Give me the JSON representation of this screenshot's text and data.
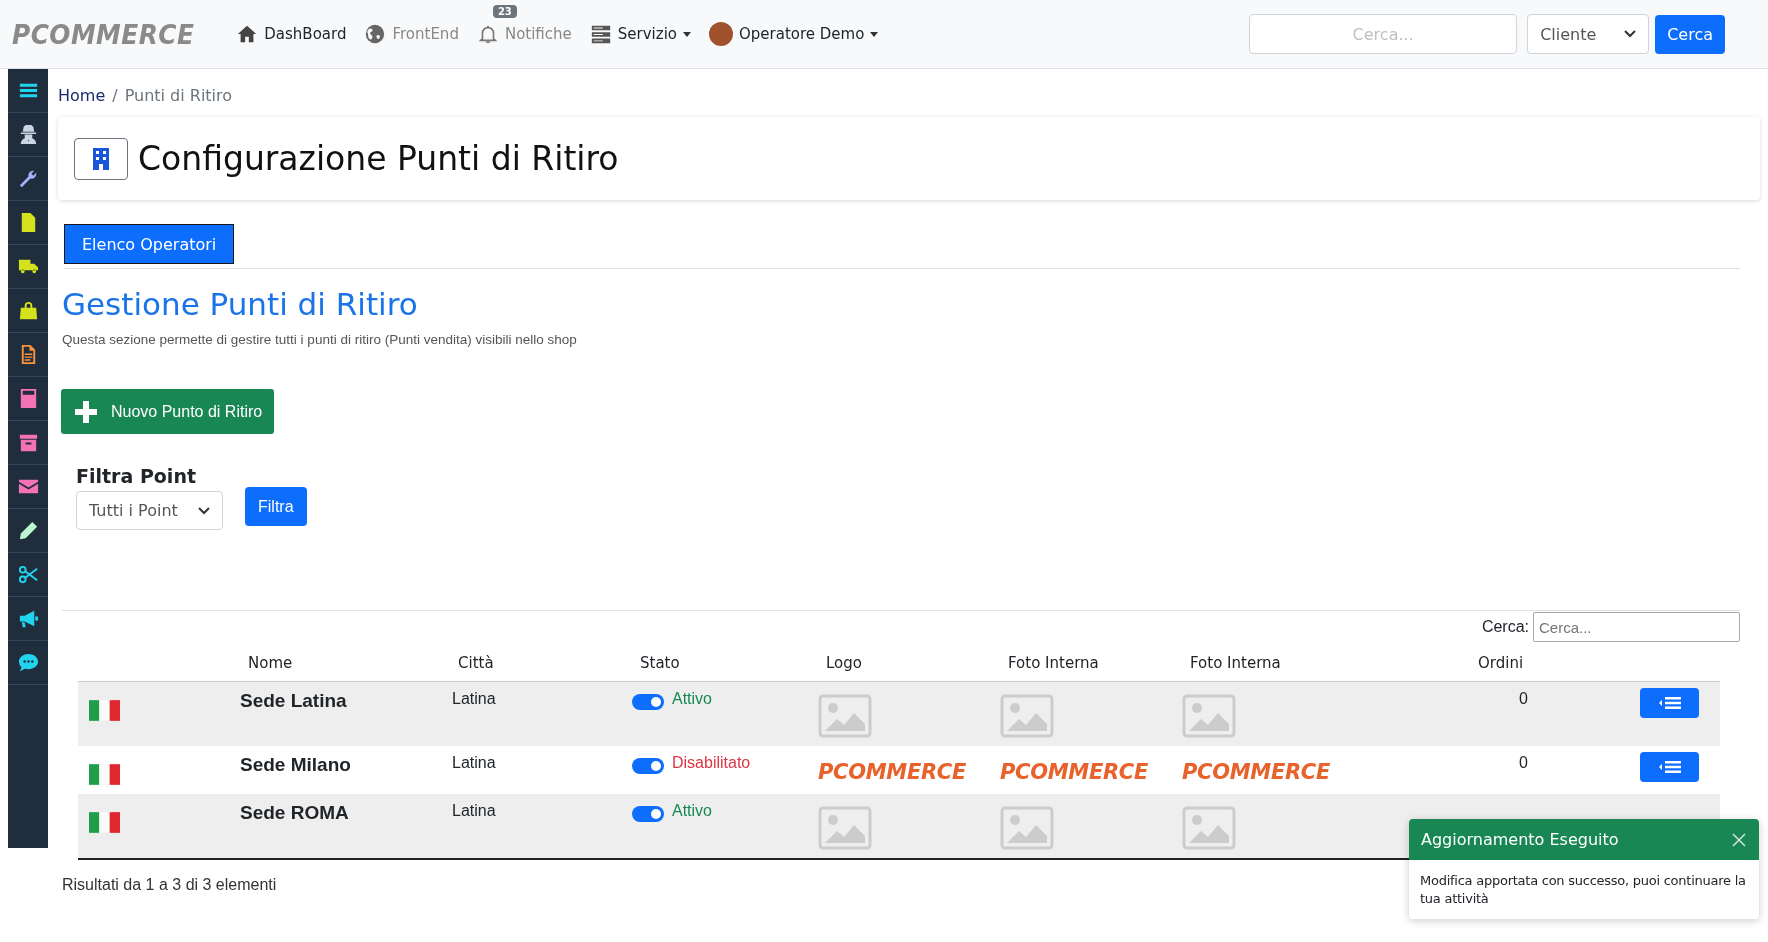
{
  "topbar": {
    "logo": "PCOMMERCE",
    "nav": [
      {
        "kind": "home",
        "label": "DashBoard",
        "muted": false,
        "caret": false
      },
      {
        "kind": "globe",
        "label": "FrontEnd",
        "muted": true,
        "caret": false
      },
      {
        "kind": "bell",
        "label": "Notifiche",
        "muted": true,
        "caret": false,
        "badge": "23"
      },
      {
        "kind": "server",
        "label": "Servizio",
        "muted": false,
        "caret": true
      },
      {
        "kind": "user",
        "label": "Operatore Demo",
        "muted": false,
        "caret": true
      }
    ],
    "search": {
      "placeholder": "Cerca..."
    },
    "scope": {
      "value": "Cliente"
    },
    "button": "Cerca"
  },
  "breadcrumb": {
    "separator": "/",
    "items": [
      {
        "label": "Home",
        "link": true
      },
      {
        "label": "Punti di Ritiro",
        "link": false
      }
    ]
  },
  "page_title": "Configurazione Punti di Ritiro",
  "tab_button": "Elenco Operatori",
  "section_title": "Gestione Punti di Ritiro",
  "section_description": "Questa sezione permette di gestire tutti i punti di ritiro (Punti vendita) visibili nello shop",
  "new_button": "Nuovo Punto di Ritiro",
  "filter": {
    "label": "Filtra Point",
    "value": "Tutti i Point",
    "button": "Filtra"
  },
  "table": {
    "search_label": "Cerca:",
    "search_placeholder": "Cerca...",
    "columns": [
      "Nome",
      "Città",
      "Stato",
      "Logo",
      "Foto Interna",
      "Foto Interna",
      "Ordini"
    ],
    "rows": [
      {
        "name": "Sede Latina",
        "city": "Latina",
        "on": true,
        "status": "Attivo",
        "active": true,
        "images": [
          {
            "kind": "placeholder"
          },
          {
            "kind": "placeholder"
          },
          {
            "kind": "placeholder"
          }
        ],
        "orders": "0"
      },
      {
        "name": "Sede Milano",
        "city": "Latina",
        "on": true,
        "status": "Disabilitato",
        "active": false,
        "images": [
          {
            "kind": "logo",
            "text": "PCOMMERCE"
          },
          {
            "kind": "logo",
            "text": "PCOMMERCE"
          },
          {
            "kind": "logo",
            "text": "PCOMMERCE"
          }
        ],
        "orders": "0"
      },
      {
        "name": "Sede ROMA",
        "city": "Latina",
        "on": true,
        "status": "Attivo",
        "active": true,
        "images": [
          {
            "kind": "placeholder"
          },
          {
            "kind": "placeholder"
          },
          {
            "kind": "placeholder"
          }
        ]
      }
    ],
    "info": "Risultati da 1 a 3 di 3 elementi"
  },
  "toast": {
    "title": "Aggiornamento Eseguito",
    "message": "Modifica apportata con successo, puoi continuare la tua attività"
  }
}
